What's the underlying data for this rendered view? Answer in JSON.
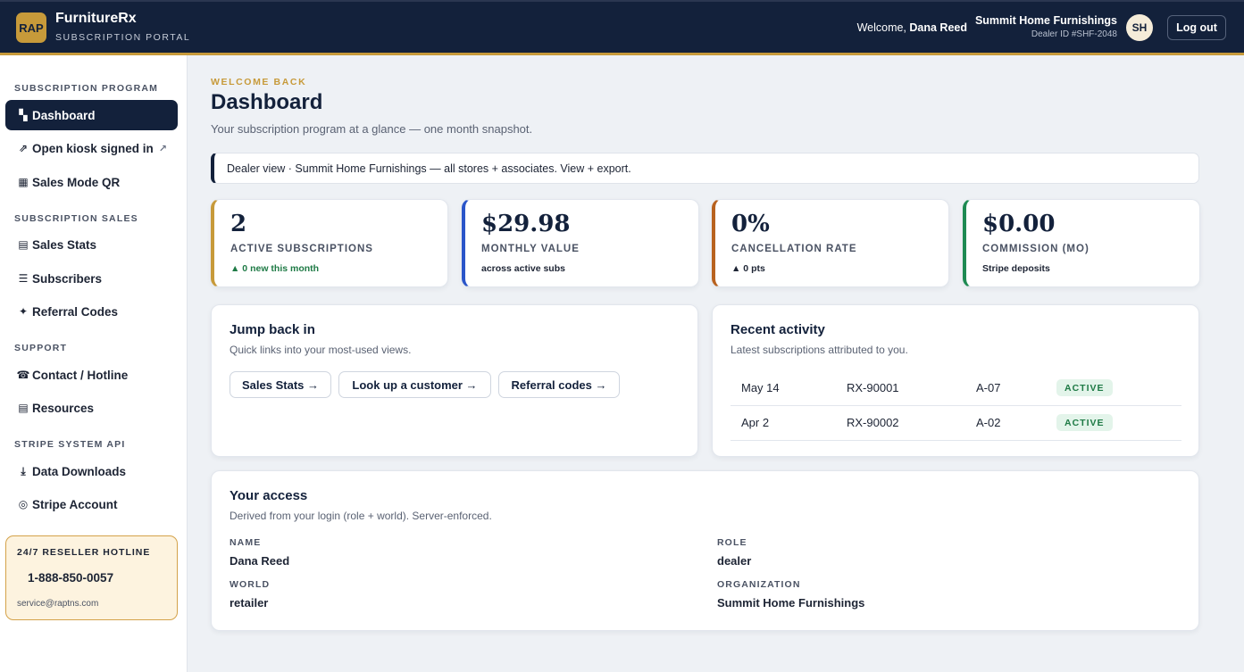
{
  "header": {
    "logo_text": "RAP",
    "brand_name": "FurnitureRx",
    "brand_sub": "SUBSCRIPTION PORTAL",
    "welcome_prefix": "Welcome, ",
    "user_name": "Dana Reed",
    "dealer_name": "Summit Home Furnishings",
    "dealer_id": "Dealer ID #SHF-2048",
    "avatar_initials": "SH",
    "logout_label": "Log out"
  },
  "sidebar": {
    "sections": [
      {
        "label": "SUBSCRIPTION PROGRAM"
      },
      {
        "label": "SUBSCRIPTION SALES"
      },
      {
        "label": "SUPPORT"
      },
      {
        "label": "STRIPE SYSTEM API"
      }
    ],
    "items": [
      {
        "label": "Dashboard",
        "icon": "dashboard-icon",
        "glyph": "▚"
      },
      {
        "label": "Open kiosk signed in",
        "icon": "kiosk-icon",
        "glyph": "⇗",
        "external": "↗"
      },
      {
        "label": "Sales Mode QR",
        "icon": "qr-icon",
        "glyph": "▦"
      },
      {
        "label": "Sales Stats",
        "icon": "stats-icon",
        "glyph": "▤"
      },
      {
        "label": "Subscribers",
        "icon": "list-icon",
        "glyph": "☰"
      },
      {
        "label": "Referral Codes",
        "icon": "sparkle-icon",
        "glyph": "✦"
      },
      {
        "label": "Contact / Hotline",
        "icon": "phone-icon",
        "glyph": "☎"
      },
      {
        "label": "Resources",
        "icon": "resources-icon",
        "glyph": "▤"
      },
      {
        "label": "Data Downloads",
        "icon": "download-icon",
        "glyph": "⤓"
      },
      {
        "label": "Stripe Account",
        "icon": "stripe-icon",
        "glyph": "◎"
      }
    ],
    "hotline": {
      "title": "24/7 RESELLER HOTLINE",
      "phone": "1-888-850-0057",
      "email": "service@raptns.com"
    }
  },
  "main": {
    "eyebrow": "WELCOME BACK",
    "title": "Dashboard",
    "subtitle": "Your subscription program at a glance — one month snapshot.",
    "notice": "Dealer view · Summit Home Furnishings — all stores + associates. View + export.",
    "stats": [
      {
        "value": "2",
        "label": "ACTIVE SUBSCRIPTIONS",
        "note": "▲ 0 new this month",
        "accent": "#c79a3a"
      },
      {
        "value": "$29.98",
        "label": "MONTHLY VALUE",
        "note": "across active subs",
        "accent": "#2a55c9"
      },
      {
        "value": "0%",
        "label": "CANCELLATION RATE",
        "note": "▲ 0 pts",
        "accent": "#b8621f"
      },
      {
        "value": "$0.00",
        "label": "COMMISSION (MO)",
        "note": "Stripe deposits",
        "accent": "#1e8a52"
      }
    ],
    "jump": {
      "title": "Jump back in",
      "subtitle": "Quick links into your most-used views.",
      "buttons": [
        "Sales Stats →",
        "Look up a customer →",
        "Referral codes →"
      ]
    },
    "activity": {
      "title": "Recent activity",
      "subtitle": "Latest subscriptions attributed to you.",
      "rows": [
        {
          "date": "May 14",
          "id": "RX-90001",
          "associate": "A-07",
          "status": "ACTIVE"
        },
        {
          "date": "Apr 2",
          "id": "RX-90002",
          "associate": "A-02",
          "status": "ACTIVE"
        }
      ]
    },
    "access": {
      "title": "Your access",
      "subtitle": "Derived from your login (role + world). Server-enforced.",
      "fields": [
        {
          "label": "NAME",
          "value": "Dana Reed"
        },
        {
          "label": "ROLE",
          "value": "dealer"
        },
        {
          "label": "WORLD",
          "value": "retailer"
        },
        {
          "label": "ORGANIZATION",
          "value": "Summit Home Furnishings"
        }
      ]
    }
  }
}
